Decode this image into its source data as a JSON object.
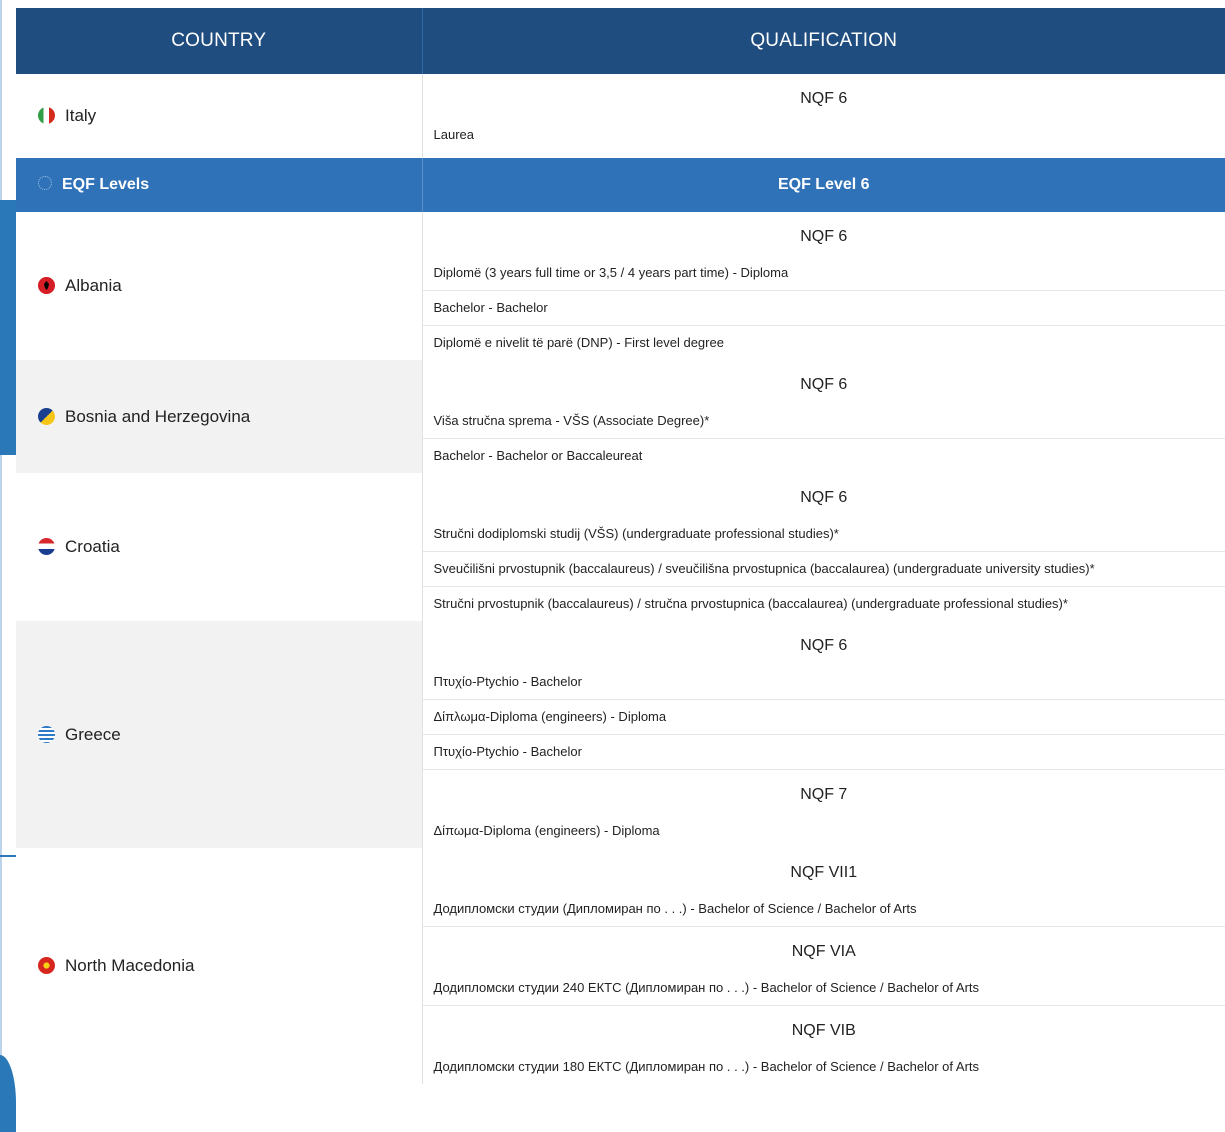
{
  "header": {
    "country": "COUNTRY",
    "qualification": "QUALIFICATION"
  },
  "italy": {
    "name": "Italy",
    "flag_colors": [
      "#2f9e44",
      "#ffffff",
      "#d52b1e"
    ],
    "groups": [
      {
        "nqf": "NQF 6",
        "items": [
          "Laurea"
        ]
      }
    ]
  },
  "eqf": {
    "label": "EQF Levels",
    "level": "EQF Level 6",
    "color": "#2f72b8"
  },
  "countries": [
    {
      "name": "Albania",
      "flag_colors": [
        "#d51e25",
        "#000000"
      ],
      "groups": [
        {
          "nqf": "NQF 6",
          "items": [
            "Diplomë (3 years full time or 3,5 / 4 years part time) - Diploma",
            "Bachelor - Bachelor",
            "Diplomë e nivelit të parë (DNP) - First level degree"
          ]
        }
      ]
    },
    {
      "name": "Bosnia and Herzegovina",
      "flag_colors": [
        "#1a3f8f",
        "#f5c518"
      ],
      "groups": [
        {
          "nqf": "NQF 6",
          "items": [
            "Viša stručna sprema - VŠS (Associate Degree)*",
            "Bachelor - Bachelor or Baccaleureat"
          ]
        }
      ]
    },
    {
      "name": "Croatia",
      "flag_colors": [
        "#d8272d",
        "#ffffff",
        "#1b3d8f"
      ],
      "groups": [
        {
          "nqf": "NQF 6",
          "items": [
            "Stručni dodiplomski studij (VŠS) (undergraduate professional studies)*",
            "Sveučilišni prvostupnik (baccalaureus) / sveučilišna prvostupnica (baccalaurea) (undergraduate university studies)*",
            "Stručni prvostupnik (baccalaureus) / stručna prvostupnica (baccalaurea) (undergraduate professional studies)*"
          ]
        }
      ]
    },
    {
      "name": "Greece",
      "flag_colors": [
        "#2d79c7",
        "#ffffff"
      ],
      "groups": [
        {
          "nqf": "NQF 6",
          "items": [
            "Πτυχίο-Ptychio - Bachelor",
            "Δίπλωμα-Diploma (engineers) - Diploma",
            "Πτυχίο-Ptychio - Bachelor"
          ]
        },
        {
          "nqf": "NQF 7",
          "items": [
            "Δίπωμα-Diploma (engineers) - Diploma"
          ]
        }
      ]
    },
    {
      "name": "North Macedonia",
      "flag_colors": [
        "#d6261e",
        "#f8d117"
      ],
      "groups": [
        {
          "nqf": "NQF VII1",
          "items": [
            "Додипломски студии (Дипломиран по . . .) - Bachelor of Science / Bachelor of Arts"
          ]
        },
        {
          "nqf": "NQF VIA",
          "items": [
            "Додипломски студии 240 ЕКТС (Дипломиран по . . .) - Bachelor of Science / Bachelor of Arts"
          ]
        },
        {
          "nqf": "NQF VIB",
          "items": [
            "Додипломски студии 180 ЕКТС (Дипломиран по . . .) - Bachelor of Science / Bachelor of Arts"
          ]
        }
      ]
    }
  ]
}
